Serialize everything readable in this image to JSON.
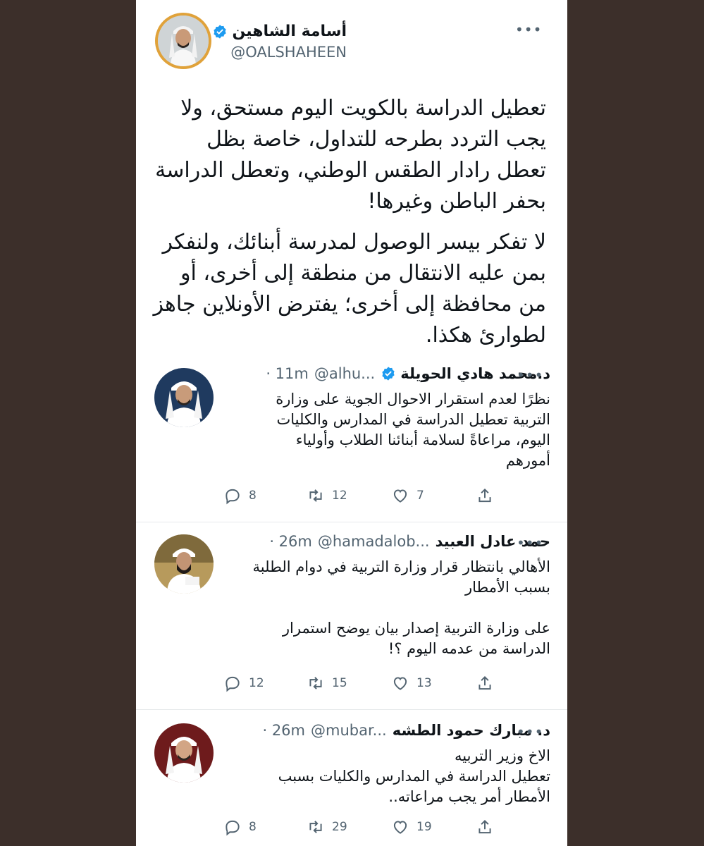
{
  "main": {
    "name": "أسامة الشاهين",
    "handle": "@OALSHAHEEN",
    "paragraph_1": "تعطيل الدراسة بالكويت اليوم مستحق، ولا يجب التردد بطرحه للتداول، خاصة بظل تعطل رادار الطقس الوطني، وتعطل الدراسة بحفر الباطن وغيرها!",
    "paragraph_2": "لا تفكر بيسر الوصول لمدرسة أبنائك، ولنفكر بمن عليه الانتقال من منطقة إلى أخرى، أو من محافظة إلى أخرى؛ يفترض الأونلاين جاهز لطوارئ هكذا."
  },
  "replies": [
    {
      "name": "د.محمد هادي الحويلة",
      "handle": "@alhu...",
      "time": "· 11m",
      "text": "نظرًا لعدم استقرار الاحوال الجوية على وزارة\nالتربية تعطيل الدراسة في المدارس والكليات\nاليوم، مراعاةً لسلامة أبنائنا الطلاب وأولياء\nأمورهم",
      "replies_count": "8",
      "retweets_count": "12",
      "likes_count": "7"
    },
    {
      "name": "حمد عادل العبيد",
      "handle": "@hamadalob...",
      "time": "· 26m",
      "text": "الأهالي بانتظار قرار وزارة التربية في دوام الطلبة\nبسبب الأمطار\n\nعلى وزارة التربية إصدار بيان يوضح استمرار\nالدراسة من عدمه اليوم ؟!",
      "replies_count": "12",
      "retweets_count": "15",
      "likes_count": "13"
    },
    {
      "name": "د. مبارك حمود الطشه",
      "handle": "@mubar...",
      "time": "· 26m",
      "text": "الاخ وزير التربيه\nتعطيل الدراسة في المدارس والكليات بسبب\nالأمطار أمر يجب مراعاته..",
      "replies_count": "8",
      "retweets_count": "29",
      "likes_count": "19"
    }
  ],
  "colors": {
    "background": "#3c2f2a",
    "verified": "#1d9bf0",
    "secondary_text": "#536471",
    "avatar_ring": "#e0a23a"
  },
  "icons": {
    "reply": "reply-icon",
    "retweet": "retweet-icon",
    "like": "heart-icon",
    "share": "share-icon",
    "verified": "verified-badge-icon",
    "more": "more-icon"
  }
}
